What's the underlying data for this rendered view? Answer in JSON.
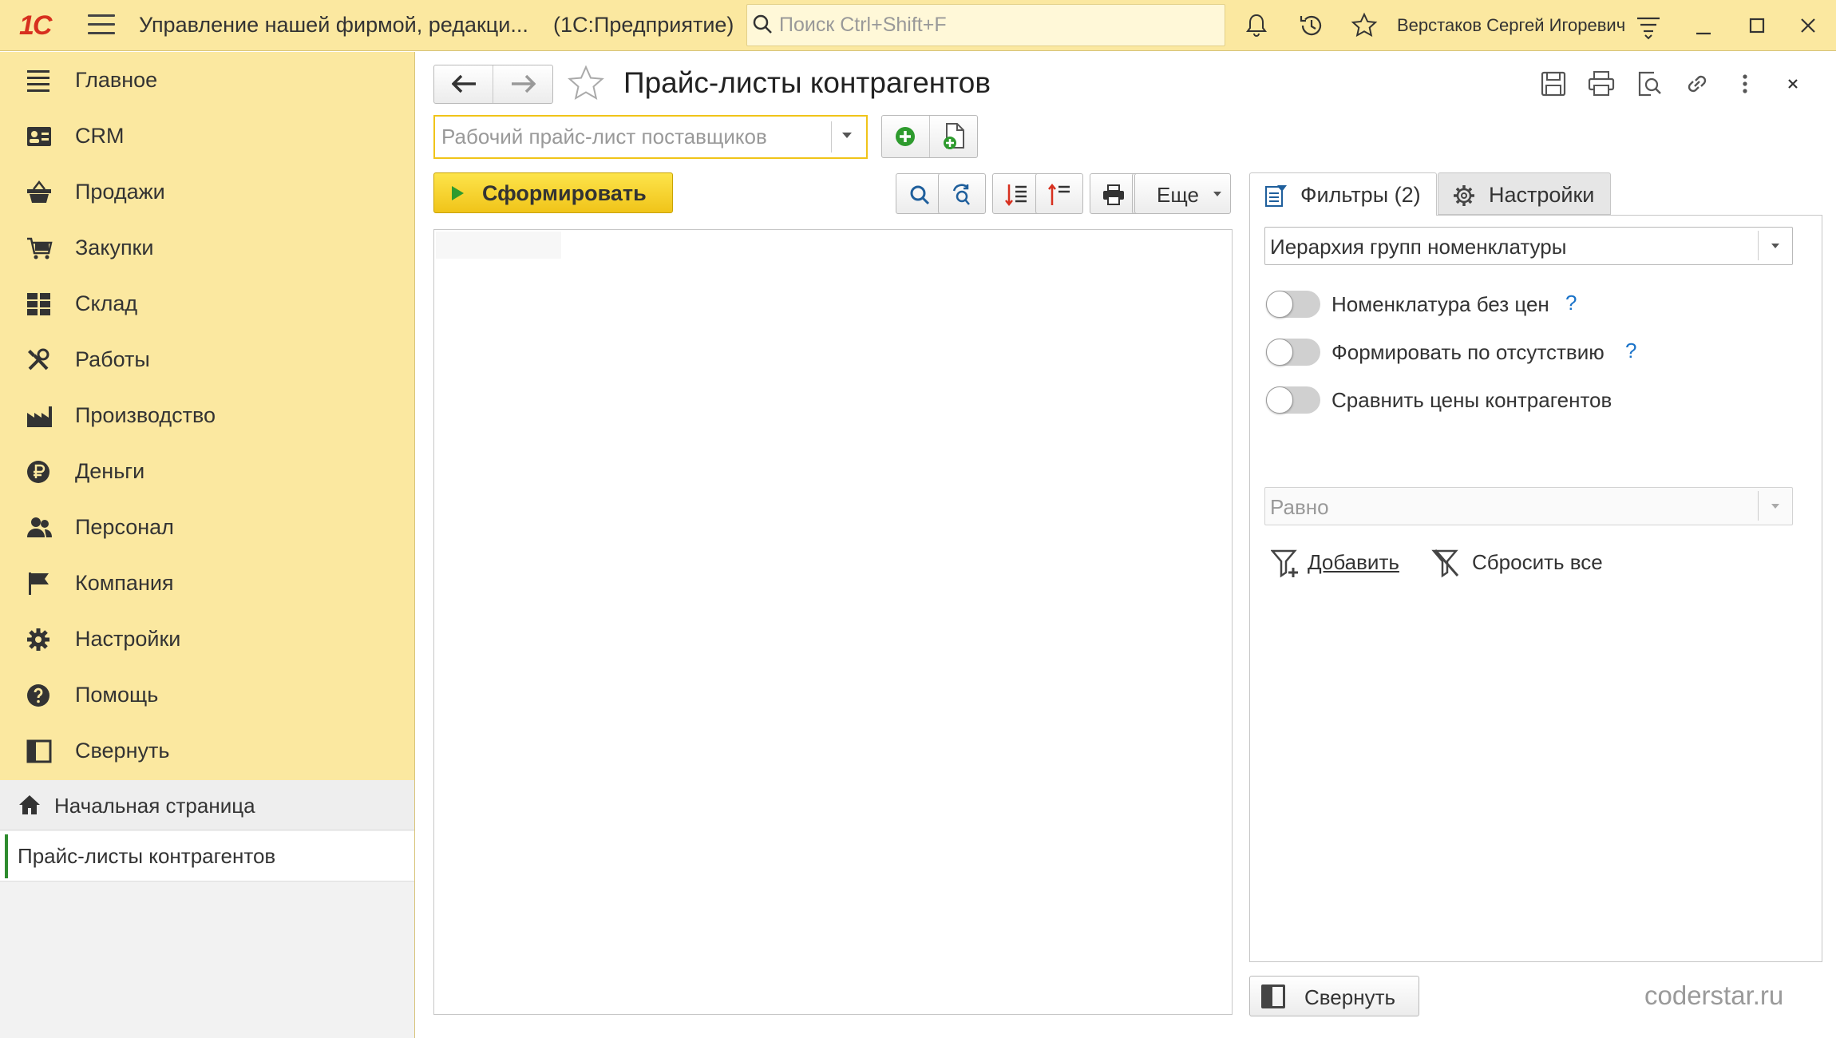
{
  "titlebar": {
    "logo": "1С",
    "app_title": "Управление нашей фирмой, редакци...",
    "app_sub": "(1С:Предприятие)",
    "search_placeholder": "Поиск Ctrl+Shift+F",
    "user_name": "Верстаков Сергей Игоревич",
    "icons": [
      "bell-icon",
      "history-icon",
      "star-icon",
      "menu-settings-icon",
      "minimize-icon",
      "maximize-icon",
      "close-icon"
    ]
  },
  "sidebar": {
    "items": [
      {
        "label": "Главное",
        "icon": "list-icon"
      },
      {
        "label": "CRM",
        "icon": "contact-card-icon"
      },
      {
        "label": "Продажи",
        "icon": "shop-basket-icon"
      },
      {
        "label": "Закупки",
        "icon": "cart-icon"
      },
      {
        "label": "Склад",
        "icon": "warehouse-grid-icon"
      },
      {
        "label": "Работы",
        "icon": "tools-icon"
      },
      {
        "label": "Производство",
        "icon": "factory-icon"
      },
      {
        "label": "Деньги",
        "icon": "ruble-icon"
      },
      {
        "label": "Персонал",
        "icon": "people-icon"
      },
      {
        "label": "Компания",
        "icon": "flag-icon"
      },
      {
        "label": "Настройки",
        "icon": "gear-icon"
      },
      {
        "label": "Помощь",
        "icon": "help-icon"
      },
      {
        "label": "Свернуть",
        "icon": "panel-collapse-icon"
      }
    ]
  },
  "open_windows": {
    "home": "Начальная страница",
    "current": "Прайс-листы контрагентов"
  },
  "form": {
    "title": "Прайс-листы контрагентов",
    "combo_placeholder": "Рабочий прайс-лист поставщиков",
    "generate_label": "Сформировать",
    "more_label": "Еще",
    "collapse_label": "Свернуть"
  },
  "settings": {
    "tab_filters": "Фильтры (2)",
    "tab_settings": "Настройки",
    "hierarchy_value": "Иерархия групп номенклатуры",
    "toggles": [
      {
        "label": "Номенклатура без цен",
        "on": false,
        "help": "?"
      },
      {
        "label": "Формировать по отсутствию",
        "on": false,
        "help": "?"
      },
      {
        "label": "Сравнить цены контрагентов",
        "on": false
      }
    ],
    "compare_value": "Равно",
    "add_label": "Добавить",
    "reset_label": "Сбросить все"
  },
  "watermark": "coderstar.ru",
  "colors": {
    "sidebar_bg": "#fbe8a0",
    "accent_yellow": "#f0c419",
    "logo_red": "#d7301f",
    "green_plus": "#2e9b2e",
    "help_blue": "#1a73c9"
  }
}
